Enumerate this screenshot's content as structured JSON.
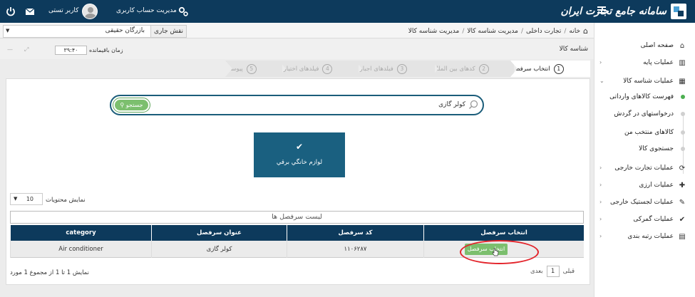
{
  "header": {
    "brand": "سامانه جامع تجارت ایران",
    "account_management": "مدیریت حساب کاربری",
    "user_name": "کاربر تستی"
  },
  "sidebar": {
    "items": [
      {
        "label": "صفحه اصلی",
        "icon": "home-icon",
        "glyph": "⌂"
      },
      {
        "label": "عملیات پایه",
        "icon": "chart-icon",
        "glyph": "▥"
      },
      {
        "label": "عملیات شناسه کالا",
        "icon": "barcode-icon",
        "glyph": "▦"
      }
    ],
    "sub_items": [
      {
        "label": "فهرست کالاهای وارداتی",
        "active": true
      },
      {
        "label": "درخواستهای در گردش",
        "active": false
      },
      {
        "label": "کالاهای منتخب من",
        "active": false
      },
      {
        "label": "جستجوی کالا",
        "active": false
      }
    ],
    "bottom_items": [
      {
        "label": "عملیات تجارت خارجی",
        "icon": "refresh-icon",
        "glyph": "⟳"
      },
      {
        "label": "عملیات ارزی",
        "icon": "user-plus-icon",
        "glyph": "✚"
      },
      {
        "label": "عملیات لجستیک خارجی",
        "icon": "edit-icon",
        "glyph": "✎"
      },
      {
        "label": "عملیات گمرکی",
        "icon": "check-icon",
        "glyph": "✔"
      },
      {
        "label": "عملیات رتبه بندی",
        "icon": "stats-icon",
        "glyph": "▤"
      }
    ]
  },
  "breadcrumb": {
    "items": [
      "خانه",
      "تجارت داخلی",
      "مدیریت شناسه کالا",
      "مدیریت شناسه کالا"
    ]
  },
  "role": {
    "label": "نقش جاری",
    "value": "بازرگان حقیقی"
  },
  "page": {
    "title": "شناسه کالا",
    "timer_label": "زمان باقیمانده",
    "timer_value": "۳۹:۴۰"
  },
  "steps": [
    {
      "num": "1",
      "label": "انتخاب سرفصل",
      "active": true
    },
    {
      "num": "2",
      "label": "کدهای بین المللی",
      "active": false
    },
    {
      "num": "3",
      "label": "فیلدهای اجباری",
      "active": false
    },
    {
      "num": "4",
      "label": "فیلدهای اختیاری",
      "active": false
    },
    {
      "num": "5",
      "label": "پیوست",
      "active": false
    }
  ],
  "search": {
    "value": "کولر گازی",
    "button_label": "جستجو"
  },
  "tile": {
    "label": "لوازم خانگي برقي"
  },
  "list": {
    "show_label": "نمایش محتویات",
    "page_size": "10",
    "title": "لیست سرفصل ها",
    "columns": [
      "انتخاب سرفصل",
      "کد سرفصل",
      "عنوان سرفصل",
      "category"
    ],
    "rows": [
      {
        "select_label": "انتخاب سرفصل",
        "code": "۱۱۰۶۲۸۷",
        "title": "کولر گازی",
        "category": "Air conditioner"
      }
    ],
    "footer_info": "نمایش 1 تا 1 از مجموع 1 مورد",
    "pager_prev": "قبلی",
    "pager_page": "1",
    "pager_next": "بعدی"
  },
  "colors": {
    "header_bg": "#0d3a5c",
    "tile_bg": "#1a6080",
    "button_green": "#7cbf6e",
    "highlight_red": "#e3242b"
  }
}
